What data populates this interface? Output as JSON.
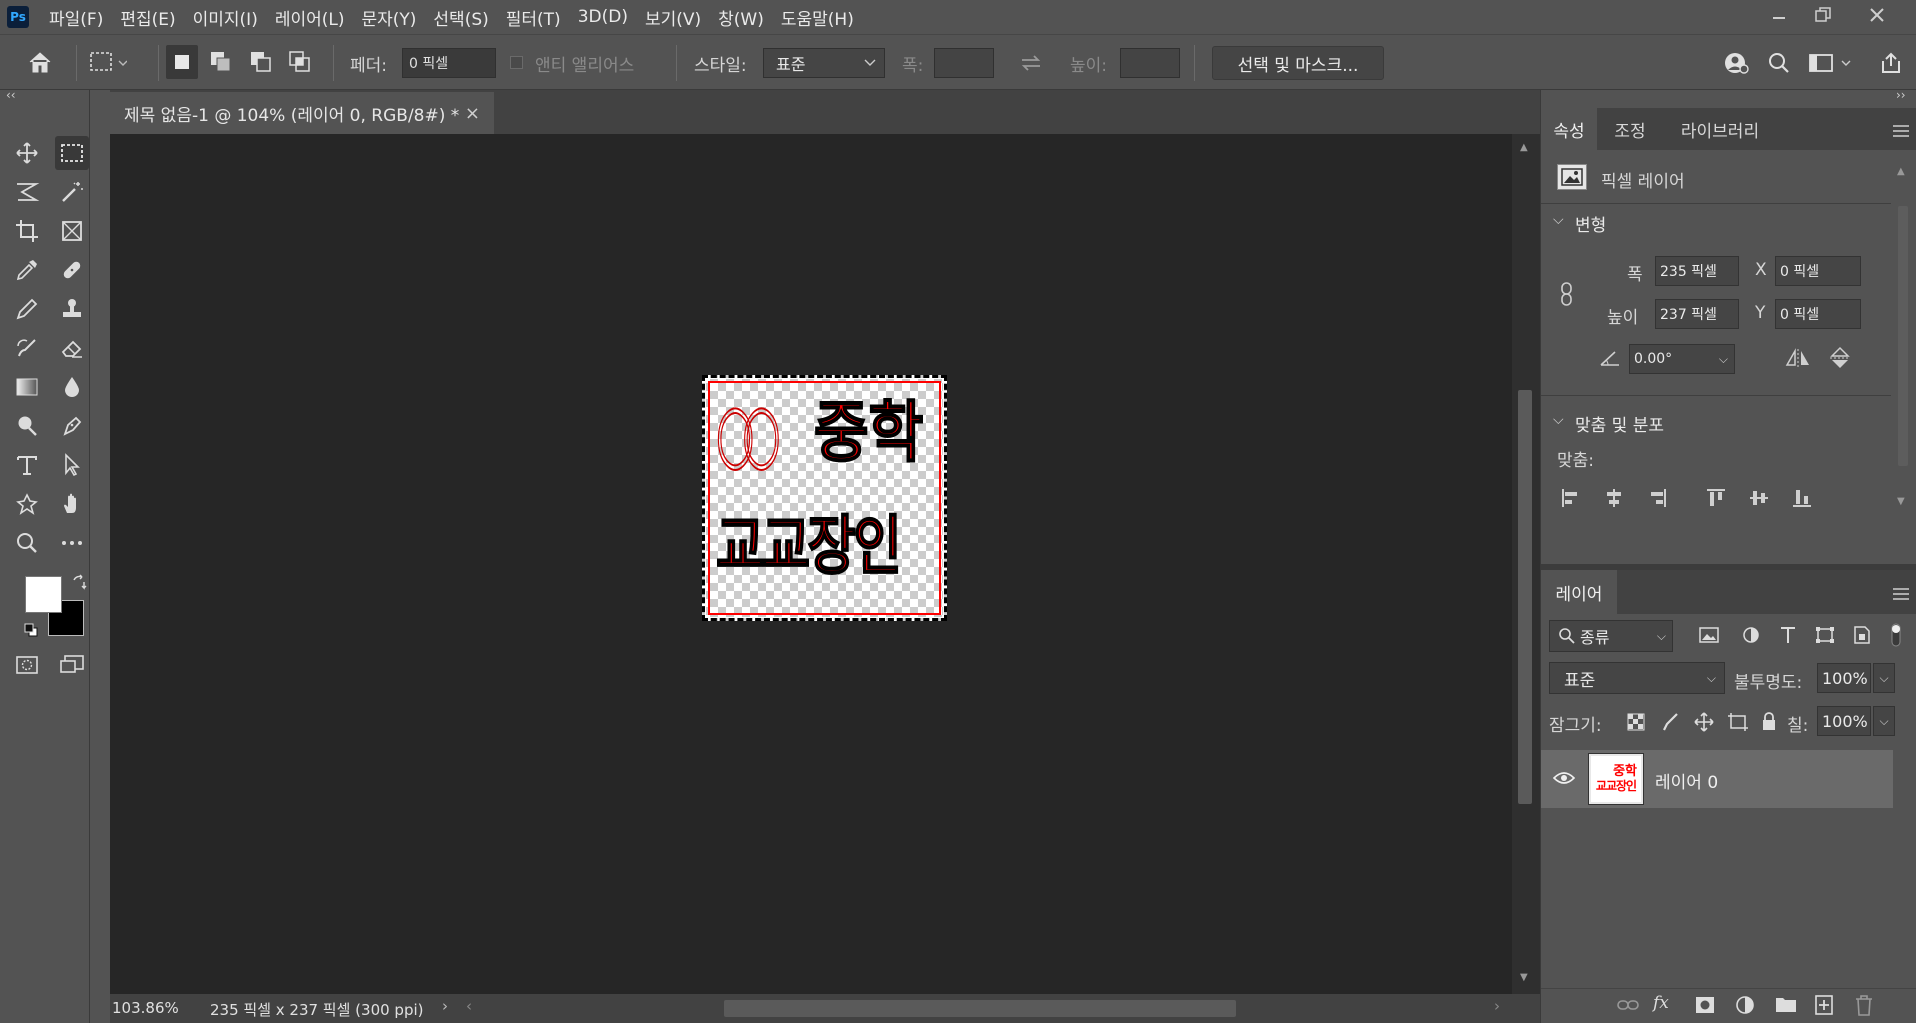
{
  "app": {
    "logo": "Ps"
  },
  "menu": [
    "파일(F)",
    "편집(E)",
    "이미지(I)",
    "레이어(L)",
    "문자(Y)",
    "선택(S)",
    "필터(T)",
    "3D(D)",
    "보기(V)",
    "창(W)",
    "도움말(H)"
  ],
  "options": {
    "feather_label": "페더:",
    "feather_value": "0 픽셀",
    "antialias_label": "앤티 앨리어스",
    "style_label": "스타일:",
    "style_value": "표준",
    "width_label": "폭:",
    "height_label": "높이:",
    "select_mask_button": "선택 및 마스크..."
  },
  "document": {
    "tab_title": "제목 없음-1 @ 104% (레이어 0, RGB/8#) *",
    "close": "×",
    "stamp": {
      "line1_circles": "○○",
      "line1_text": "중학",
      "line2_text": "교교장인",
      "color": "#ff0000"
    }
  },
  "status": {
    "zoom": "103.86%",
    "info": "235 픽셀 x 237 픽셀 (300 ppi)"
  },
  "properties": {
    "tabs": [
      "속성",
      "조정",
      "라이브러리"
    ],
    "layer_type": "픽셀 레이어",
    "transform_header": "변형",
    "width_label": "폭",
    "width_value": "235 픽셀",
    "height_label": "높이",
    "height_value": "237 픽셀",
    "x_label": "X",
    "x_value": "0 픽셀",
    "y_label": "Y",
    "y_value": "0 픽셀",
    "angle_value": "0.00°",
    "align_header": "맞춤 및 분포",
    "align_label": "맞춤:"
  },
  "layers": {
    "tab": "레이어",
    "filter_value": "종류",
    "blend_mode": "표준",
    "opacity_label": "불투명도:",
    "opacity_value": "100%",
    "lock_label": "잠그기:",
    "fill_label": "칠:",
    "fill_value": "100%",
    "items": [
      {
        "name": "레이어 0",
        "thumb_line1": "중학",
        "thumb_line2": "교교장인"
      }
    ]
  },
  "colors": {
    "foreground": "#ffffff",
    "background": "#000000",
    "ui_dark": "#535353",
    "canvas_bg": "#262626"
  }
}
